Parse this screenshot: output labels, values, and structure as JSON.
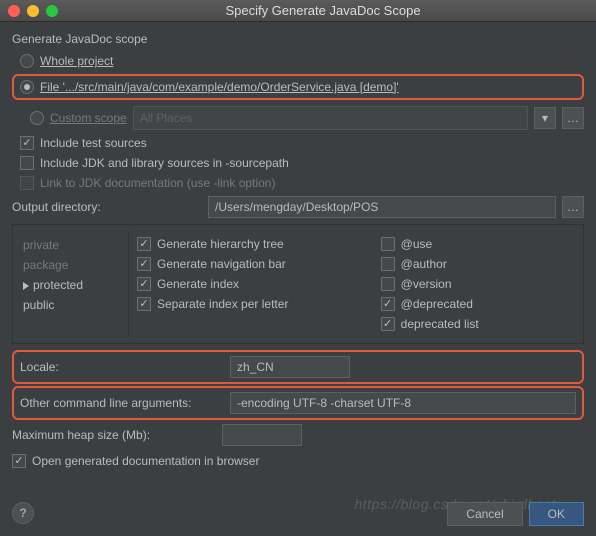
{
  "window_title": "Specify Generate JavaDoc Scope",
  "section_title": "Generate JavaDoc scope",
  "scope": {
    "whole_project": "Whole project",
    "file": "File '.../src/main/java/com/example/demo/OrderService.java [demo]'",
    "custom_scope": "Custom scope",
    "custom_scope_placeholder": "All Places",
    "include_test": "Include test sources",
    "include_jdk": "Include JDK and library sources in -sourcepath",
    "link_jdk": "Link to JDK documentation (use -link option)"
  },
  "output_dir_label": "Output directory:",
  "output_dir_value": "/Users/mengday/Desktop/POS",
  "visibility": {
    "private": "private",
    "package": "package",
    "protected": "protected",
    "public": "public"
  },
  "gen_opts": {
    "hierarchy": "Generate hierarchy tree",
    "nav": "Generate navigation bar",
    "index": "Generate index",
    "sep_index": "Separate index per letter"
  },
  "tags": {
    "use": "@use",
    "author": "@author",
    "version": "@version",
    "deprecated": "@deprecated",
    "deprecated_list": "deprecated list"
  },
  "locale_label": "Locale:",
  "locale_value": "zh_CN",
  "other_args_label": "Other command line arguments:",
  "other_args_value": "-encoding UTF-8 -charset UTF-8",
  "heap_label": "Maximum heap size (Mb):",
  "heap_value": "",
  "open_browser": "Open generated documentation in browser",
  "cancel": "Cancel",
  "ok": "OK",
  "watermark": "https://blog.csdn.net/vbirdbest"
}
